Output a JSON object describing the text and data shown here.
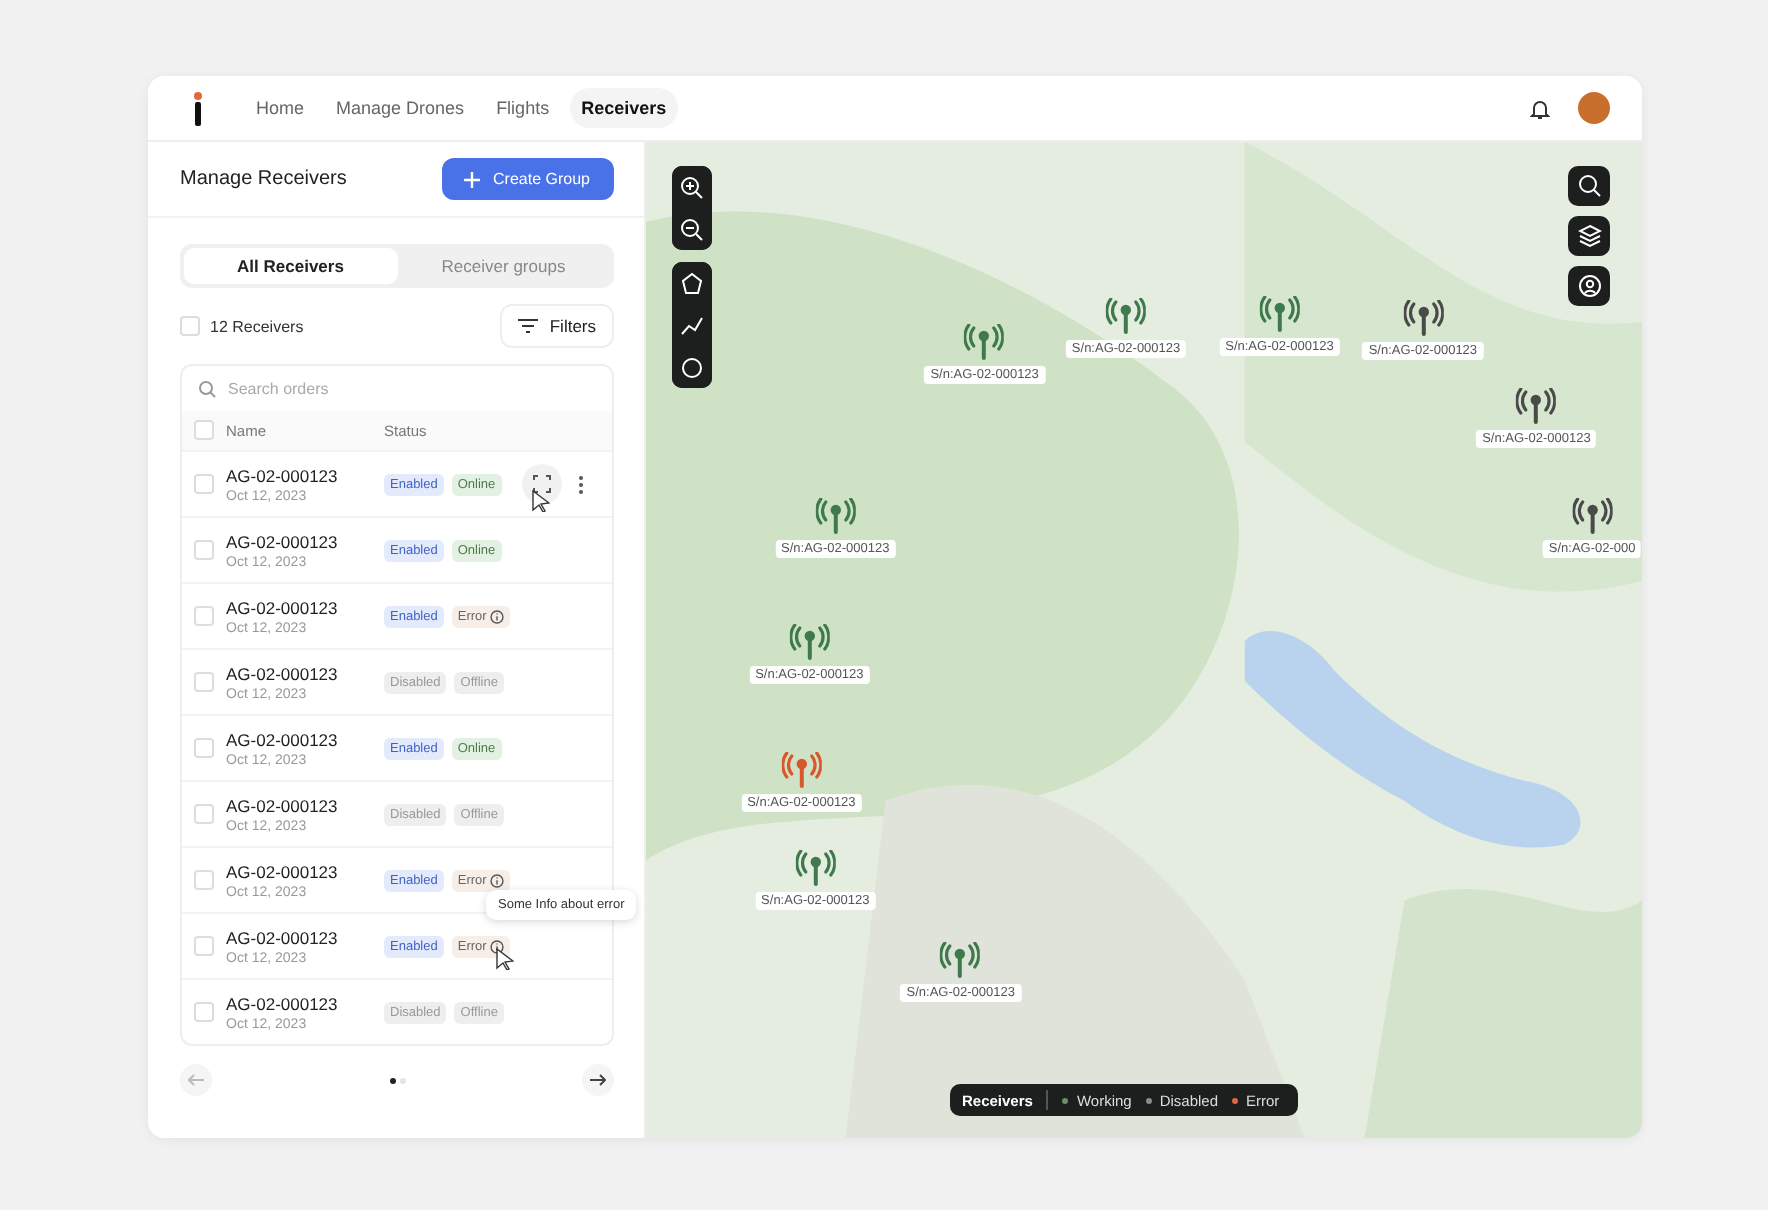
{
  "nav": {
    "tabs": [
      {
        "label": "Home",
        "selected": false
      },
      {
        "label": "Manage Drones",
        "selected": false
      },
      {
        "label": "Flights",
        "selected": false
      },
      {
        "label": "Receivers",
        "selected": true
      }
    ]
  },
  "panel": {
    "title": "Manage Receivers",
    "create_button": "Create Group",
    "segments": [
      {
        "label": "All Receivers",
        "selected": true
      },
      {
        "label": "Receiver groups",
        "selected": false
      }
    ],
    "count": "12 Receivers",
    "select_all_checked": false,
    "header_checked": false,
    "filters_button": "Filters",
    "search": {
      "placeholder": "Search orders"
    },
    "columns": [
      "Name",
      "Status"
    ],
    "rows": [
      {
        "name": "AG-02-000123",
        "date": "Oct 12, 2023",
        "checked": false,
        "enabled": true,
        "enabled_label": "Enabled",
        "kind": "online",
        "state_label": "Online",
        "hovered": true
      },
      {
        "name": "AG-02-000123",
        "date": "Oct 12, 2023",
        "checked": false,
        "enabled": true,
        "enabled_label": "Enabled",
        "kind": "online",
        "state_label": "Online",
        "hovered": false
      },
      {
        "name": "AG-02-000123",
        "date": "Oct 12, 2023",
        "checked": false,
        "enabled": true,
        "enabled_label": "Enabled",
        "kind": "error",
        "state_label": "Error",
        "hovered": false
      },
      {
        "name": "AG-02-000123",
        "date": "Oct 12, 2023",
        "checked": false,
        "enabled": false,
        "enabled_label": "Disabled",
        "kind": "offline",
        "state_label": "Offline",
        "hovered": false
      },
      {
        "name": "AG-02-000123",
        "date": "Oct 12, 2023",
        "checked": false,
        "enabled": true,
        "enabled_label": "Enabled",
        "kind": "online",
        "state_label": "Online",
        "hovered": false
      },
      {
        "name": "AG-02-000123",
        "date": "Oct 12, 2023",
        "checked": false,
        "enabled": false,
        "enabled_label": "Disabled",
        "kind": "offline",
        "state_label": "Offline",
        "hovered": false
      },
      {
        "name": "AG-02-000123",
        "date": "Oct 12, 2023",
        "checked": false,
        "enabled": true,
        "enabled_label": "Enabled",
        "kind": "error",
        "state_label": "Error",
        "hovered": false
      },
      {
        "name": "AG-02-000123",
        "date": "Oct 12, 2023",
        "checked": false,
        "enabled": true,
        "enabled_label": "Enabled",
        "kind": "error",
        "state_label": "Error",
        "hovered": false,
        "tooltip": "Some Info about error"
      },
      {
        "name": "AG-02-000123",
        "date": "Oct 12, 2023",
        "checked": false,
        "enabled": false,
        "enabled_label": "Disabled",
        "kind": "offline",
        "state_label": "Offline",
        "hovered": false
      }
    ],
    "pages": [
      {
        "selected": true
      },
      {
        "selected": false
      }
    ]
  },
  "map": {
    "markers": [
      {
        "kind": "working",
        "label": "S/n:AG-02-000123"
      },
      {
        "kind": "working",
        "label": "S/n:AG-02-000123"
      },
      {
        "kind": "working",
        "label": "S/n:AG-02-000123"
      },
      {
        "kind": "disabled",
        "label": "S/n:AG-02-000123"
      },
      {
        "kind": "disabled",
        "label": "S/n:AG-02-000123"
      },
      {
        "kind": "disabled",
        "label": "S/n:AG-02-000"
      },
      {
        "kind": "working",
        "label": "S/n:AG-02-000123"
      },
      {
        "kind": "working",
        "label": "S/n:AG-02-000123"
      },
      {
        "kind": "error",
        "label": "S/n:AG-02-000123"
      },
      {
        "kind": "working",
        "label": "S/n:AG-02-000123"
      },
      {
        "kind": "working",
        "label": "S/n:AG-02-000123"
      }
    ],
    "legend": {
      "title": "Receivers",
      "items": [
        {
          "label": "Working",
          "color": "#6b8f6f"
        },
        {
          "label": "Disabled",
          "color": "#8a8a8a"
        },
        {
          "label": "Error",
          "color": "#e2683c"
        }
      ]
    }
  }
}
